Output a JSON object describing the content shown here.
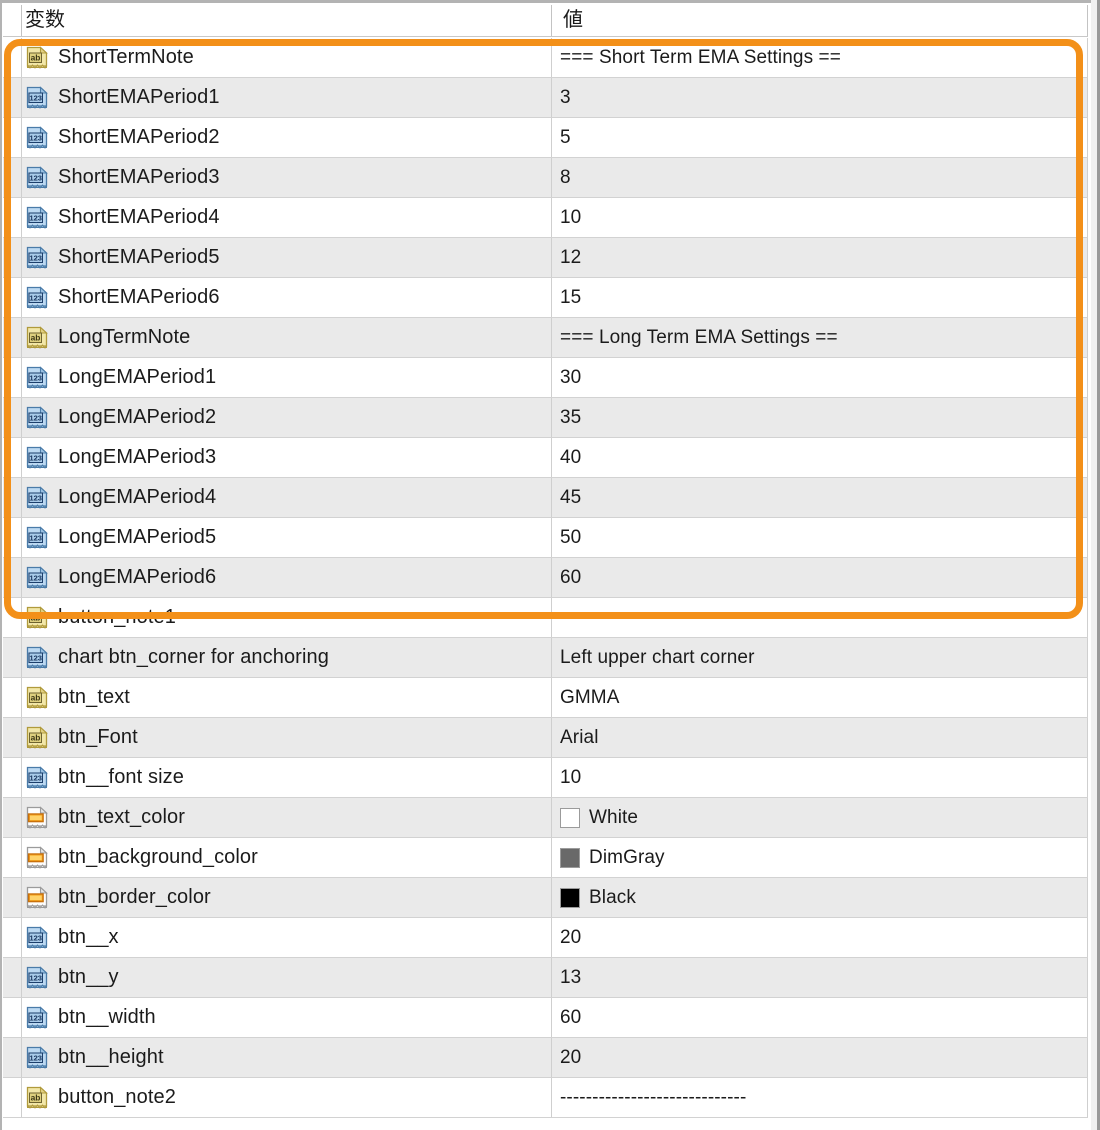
{
  "window": {
    "title": "",
    "accent_color": "#f39019",
    "row_alt_color": "#eaeaea",
    "row_color": "#ffffff",
    "grid_line_color": "#d2d2d2"
  },
  "header": {
    "col_variable": "変数",
    "col_value": "値"
  },
  "highlight": {
    "label": "highlight-region",
    "color": "#f39019",
    "covers_rows": "ShortTermNote through LongEMAPeriod6"
  },
  "rows": [
    {
      "icon": "string-type-icon",
      "icon_kind": "ab",
      "name": "ShortTermNote",
      "value": "=== Short Term EMA Settings ==",
      "value_kind": "text"
    },
    {
      "icon": "number-type-icon",
      "icon_kind": "123",
      "name": "ShortEMAPeriod1",
      "value": "3",
      "value_kind": "text"
    },
    {
      "icon": "number-type-icon",
      "icon_kind": "123",
      "name": "ShortEMAPeriod2",
      "value": "5",
      "value_kind": "text"
    },
    {
      "icon": "number-type-icon",
      "icon_kind": "123",
      "name": "ShortEMAPeriod3",
      "value": "8",
      "value_kind": "text"
    },
    {
      "icon": "number-type-icon",
      "icon_kind": "123",
      "name": "ShortEMAPeriod4",
      "value": "10",
      "value_kind": "text"
    },
    {
      "icon": "number-type-icon",
      "icon_kind": "123",
      "name": "ShortEMAPeriod5",
      "value": "12",
      "value_kind": "text"
    },
    {
      "icon": "number-type-icon",
      "icon_kind": "123",
      "name": "ShortEMAPeriod6",
      "value": "15",
      "value_kind": "text"
    },
    {
      "icon": "string-type-icon",
      "icon_kind": "ab",
      "name": "LongTermNote",
      "value": "=== Long Term EMA Settings ==",
      "value_kind": "text"
    },
    {
      "icon": "number-type-icon",
      "icon_kind": "123",
      "name": "LongEMAPeriod1",
      "value": "30",
      "value_kind": "text"
    },
    {
      "icon": "number-type-icon",
      "icon_kind": "123",
      "name": "LongEMAPeriod2",
      "value": "35",
      "value_kind": "text"
    },
    {
      "icon": "number-type-icon",
      "icon_kind": "123",
      "name": "LongEMAPeriod3",
      "value": "40",
      "value_kind": "text"
    },
    {
      "icon": "number-type-icon",
      "icon_kind": "123",
      "name": "LongEMAPeriod4",
      "value": "45",
      "value_kind": "text"
    },
    {
      "icon": "number-type-icon",
      "icon_kind": "123",
      "name": "LongEMAPeriod5",
      "value": "50",
      "value_kind": "text"
    },
    {
      "icon": "number-type-icon",
      "icon_kind": "123",
      "name": "LongEMAPeriod6",
      "value": "60",
      "value_kind": "text"
    },
    {
      "icon": "string-type-icon",
      "icon_kind": "ab",
      "name": "button_note1",
      "value": "-----------------------------",
      "value_kind": "text"
    },
    {
      "icon": "number-type-icon",
      "icon_kind": "123",
      "name": "chart btn_corner for anchoring",
      "value": "Left upper chart corner",
      "value_kind": "text"
    },
    {
      "icon": "string-type-icon",
      "icon_kind": "ab",
      "name": "btn_text",
      "value": "GMMA",
      "value_kind": "text"
    },
    {
      "icon": "string-type-icon",
      "icon_kind": "ab",
      "name": "btn_Font",
      "value": "Arial",
      "value_kind": "text"
    },
    {
      "icon": "number-type-icon",
      "icon_kind": "123",
      "name": "btn__font size",
      "value": "10",
      "value_kind": "text"
    },
    {
      "icon": "color-type-icon",
      "icon_kind": "color",
      "name": "btn_text_color",
      "value": "White",
      "value_kind": "color",
      "swatch": "#ffffff"
    },
    {
      "icon": "color-type-icon",
      "icon_kind": "color",
      "name": "btn_background_color",
      "value": "DimGray",
      "value_kind": "color",
      "swatch": "#696969"
    },
    {
      "icon": "color-type-icon",
      "icon_kind": "color",
      "name": "btn_border_color",
      "value": "Black",
      "value_kind": "color",
      "swatch": "#000000"
    },
    {
      "icon": "number-type-icon",
      "icon_kind": "123",
      "name": "btn__x",
      "value": "20",
      "value_kind": "text"
    },
    {
      "icon": "number-type-icon",
      "icon_kind": "123",
      "name": "btn__y",
      "value": "13",
      "value_kind": "text"
    },
    {
      "icon": "number-type-icon",
      "icon_kind": "123",
      "name": "btn__width",
      "value": "60",
      "value_kind": "text"
    },
    {
      "icon": "number-type-icon",
      "icon_kind": "123",
      "name": "btn__height",
      "value": "20",
      "value_kind": "text"
    },
    {
      "icon": "string-type-icon",
      "icon_kind": "ab",
      "name": "button_note2",
      "value": "-----------------------------",
      "value_kind": "text"
    }
  ]
}
